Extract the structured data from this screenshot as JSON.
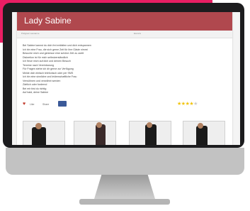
{
  "site": {
    "title": "Lady Sabine"
  },
  "breadcrumb": {
    "left": "Polignac Lausanne",
    "right": "Escorts"
  },
  "profile": {
    "text_lines": [
      "Bei Sabine kannst du dich frei entfalten und dich entspannen",
      "Ich bin eine Frau, die sich gerne Zeit für ihre Gäste nimmt",
      "Besuche mich und geniesse eine schöne Zeit zu zweit",
      "Diskretion ist für mich selbstverständlich",
      "Ich freue mich auf dich und deinen Besuch",
      "Termine nach Vereinbarung",
      "Für Fragen stehe ich dir gerne zur Verfügung",
      "Melde dich einfach telefonisch oder per SMS",
      "Ich bin eine sinnliche und leidenschaftliche Frau",
      "Verwöhnen und verwöhnt werden",
      "Zärtlich oder fordernd",
      "Bei mir bist du richtig",
      "Auf bald, deine Sabine"
    ]
  },
  "meta": {
    "favorite_label": "Like",
    "share_label": "Share",
    "facebook_label": "",
    "rating_value": 4,
    "rating_max": 5
  },
  "colors": {
    "accent": "#e91e63",
    "header": "#b0484e",
    "star": "#f1c40f"
  }
}
